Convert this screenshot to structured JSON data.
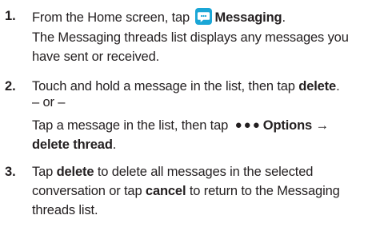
{
  "steps": [
    {
      "number": "1.",
      "lines": [
        {
          "pre": "From the Home screen, tap ",
          "icon": "messaging-app-icon",
          "bold": "Messaging",
          "post": "."
        },
        {
          "text": "The Messaging threads list displays any messages you"
        },
        {
          "text": "have sent or received."
        }
      ]
    },
    {
      "number": "2.",
      "lines": [
        {
          "pre": "Touch and hold a message in the list, then tap ",
          "bold": "delete",
          "post": "."
        },
        {
          "text": "– or –"
        },
        {
          "pre": "Tap a message in the list, then tap ",
          "dots": "●●●",
          "bold": "Options →",
          "post": ""
        },
        {
          "bold": "delete thread",
          "post": "."
        }
      ]
    },
    {
      "number": "3.",
      "lines": [
        {
          "pre": "Tap ",
          "bold": "delete",
          "post": " to delete all messages in the selected"
        },
        {
          "pre": "conversation or tap ",
          "bold": "cancel",
          "post": " to return to the Messaging"
        },
        {
          "text": "threads list."
        }
      ]
    }
  ]
}
